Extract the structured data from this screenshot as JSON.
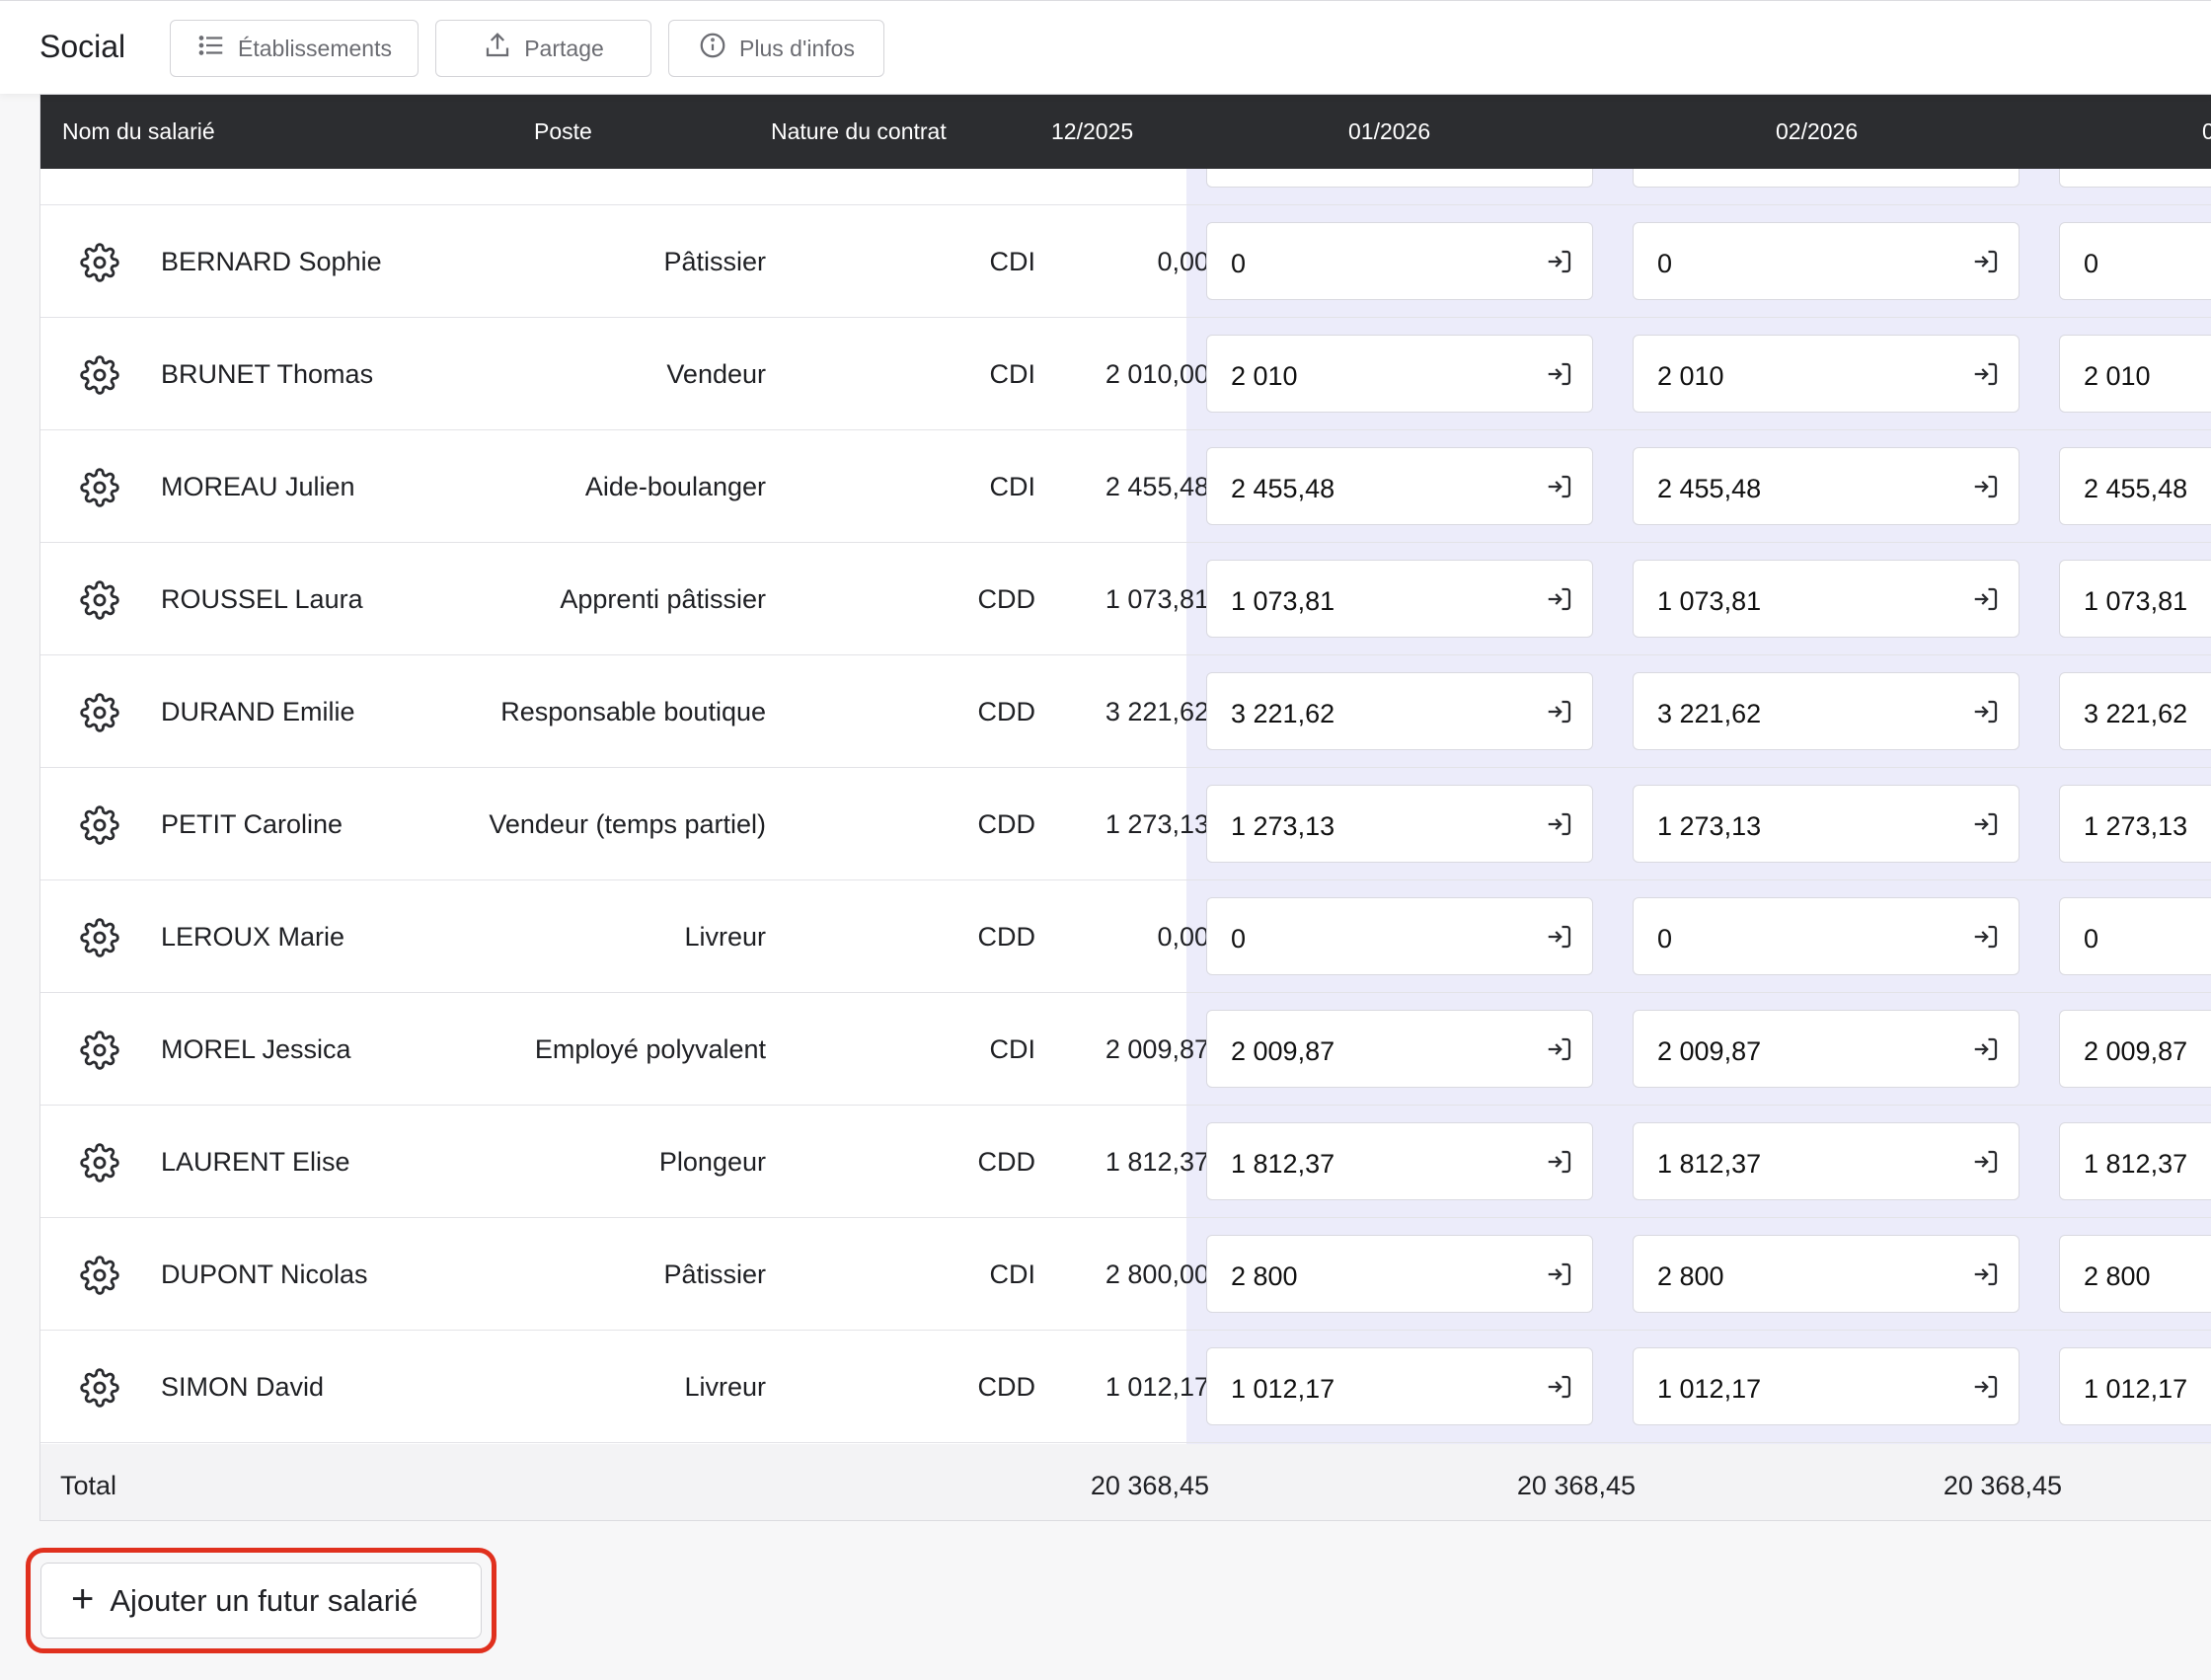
{
  "app": {
    "title": "Social",
    "toolbar": {
      "etablissements": "Établissements",
      "partage": "Partage",
      "infos": "Plus d'infos"
    }
  },
  "table": {
    "headers": {
      "name": "Nom du salarié",
      "poste": "Poste",
      "contrat": "Nature du contrat",
      "m1": "12/2025",
      "m2": "01/2026",
      "m3": "02/2026",
      "m4": "0"
    },
    "rows": [
      {
        "name": "BERNARD Sophie",
        "poste": "Pâtissier",
        "contrat": "CDI",
        "value": "0,00",
        "input": "0"
      },
      {
        "name": "BRUNET Thomas",
        "poste": "Vendeur",
        "contrat": "CDI",
        "value": "2 010,00",
        "input": "2 010"
      },
      {
        "name": "MOREAU Julien",
        "poste": "Aide-boulanger",
        "contrat": "CDI",
        "value": "2 455,48",
        "input": "2 455,48"
      },
      {
        "name": "ROUSSEL Laura",
        "poste": "Apprenti pâtissier",
        "contrat": "CDD",
        "value": "1 073,81",
        "input": "1 073,81"
      },
      {
        "name": "DURAND Emilie",
        "poste": "Responsable boutique",
        "contrat": "CDD",
        "value": "3 221,62",
        "input": "3 221,62"
      },
      {
        "name": "PETIT Caroline",
        "poste": "Vendeur (temps partiel)",
        "contrat": "CDD",
        "value": "1 273,13",
        "input": "1 273,13"
      },
      {
        "name": "LEROUX Marie",
        "poste": "Livreur",
        "contrat": "CDD",
        "value": "0,00",
        "input": "0"
      },
      {
        "name": "MOREL Jessica",
        "poste": "Employé polyvalent",
        "contrat": "CDI",
        "value": "2 009,87",
        "input": "2 009,87"
      },
      {
        "name": "LAURENT Elise",
        "poste": "Plongeur",
        "contrat": "CDD",
        "value": "1 812,37",
        "input": "1 812,37"
      },
      {
        "name": "DUPONT Nicolas",
        "poste": "Pâtissier",
        "contrat": "CDI",
        "value": "2 800,00",
        "input": "2 800"
      },
      {
        "name": "SIMON David",
        "poste": "Livreur",
        "contrat": "CDD",
        "value": "1 012,17",
        "input": "1 012,17"
      }
    ],
    "total": {
      "label": "Total",
      "m1": "20 368,45",
      "m2": "20 368,45",
      "m3": "20 368,45"
    }
  },
  "actions": {
    "add_employee": "Ajouter un futur salarié"
  },
  "colors": {
    "header_bg": "#2c2d30",
    "highlight_col": "#ececfa",
    "callout_red": "#e0301e"
  },
  "icons": {
    "row_settings": "gear-icon",
    "input_apply": "arrow-right-to-bracket-icon"
  }
}
